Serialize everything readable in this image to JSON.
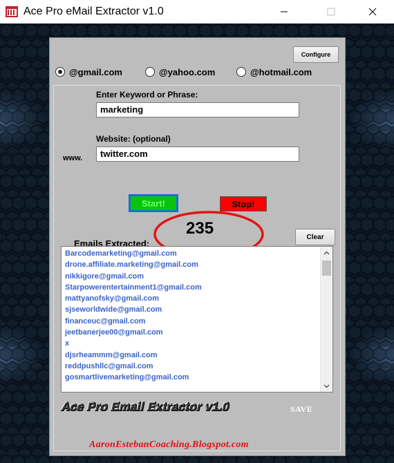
{
  "window": {
    "title": "Ace Pro eMail Extractor v1.0"
  },
  "toolbar": {
    "configure_label": "Configure"
  },
  "domains": [
    {
      "label": "@gmail.com",
      "selected": true
    },
    {
      "label": "@yahoo.com",
      "selected": false
    },
    {
      "label": "@hotmail.com",
      "selected": false
    }
  ],
  "form": {
    "keyword_label": "Enter Keyword or Phrase:",
    "keyword_value": "marketing",
    "website_label": "Website: (optional)",
    "website_prefix": "www.",
    "website_value": "twitter.com"
  },
  "actions": {
    "start_label": "Start!",
    "stop_label": "Stop!",
    "clear_label": "Clear",
    "save_label": "SAVE"
  },
  "results": {
    "label": "Emails Extracted:",
    "count": "235",
    "emails": [
      "Barcodemarketing@gmail.com",
      "drone.affiliate.marketing@gmail.com",
      "nikkigore@gmail.com",
      "Starpowerentertainment1@gmail.com",
      "mattyanofsky@gmail.com",
      "sjseworldwide@gmail.com",
      "financeuc@gmail.com",
      "jeetbanerjee00@gmail.com",
      "x",
      "djsrheammm@gmail.com",
      "reddpushllc@gmail.com",
      "gosmartlivemarketing@gmail.com"
    ]
  },
  "branding": {
    "footer_title": "Ace Pro Email Extractor v1.0",
    "blog": "AaronEstebanCoaching.Blogspot.com"
  },
  "colors": {
    "start_bg": "#08c40c",
    "stop_bg": "#ff0000",
    "email_text": "#3a63c8",
    "annotation": "#e01515",
    "blog_text": "#e01010"
  }
}
